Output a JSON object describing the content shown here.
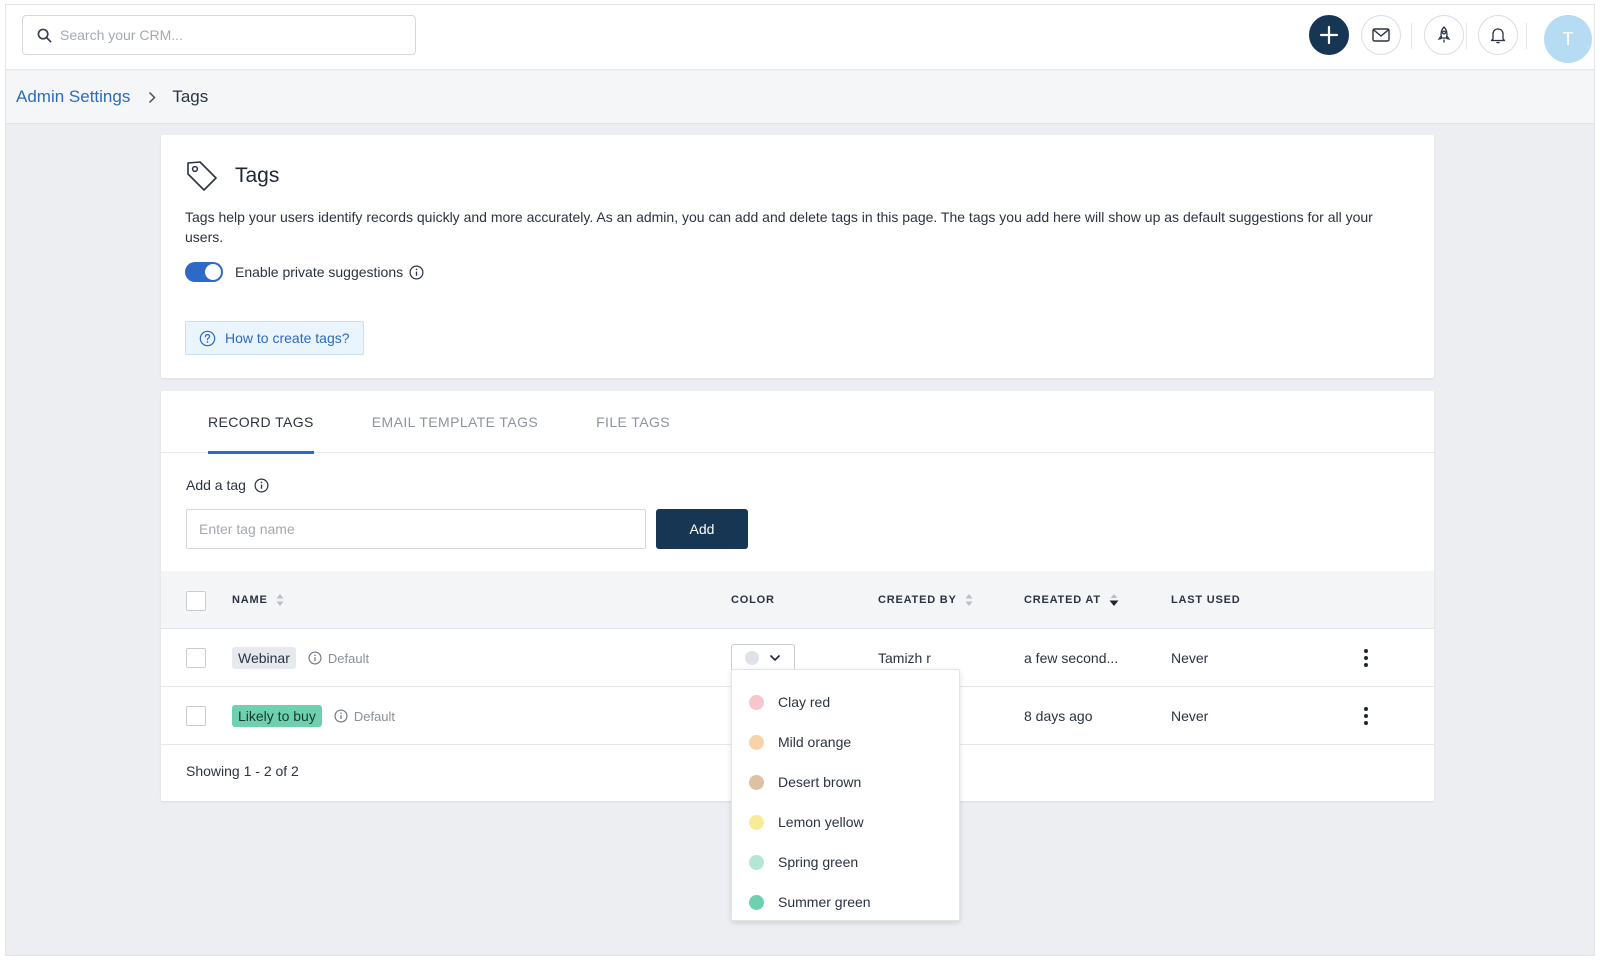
{
  "topbar": {
    "search_placeholder": "Search your CRM...",
    "avatar_initial": "T"
  },
  "breadcrumb": {
    "parent": "Admin Settings",
    "current": "Tags"
  },
  "info": {
    "title": "Tags",
    "description": "Tags help your users identify records quickly and more accurately. As an admin, you can add and delete tags in this page. The tags you add here will show up as default suggestions for all your users.",
    "toggle_label": "Enable private suggestions",
    "toggle_on": true,
    "help_label": "How to create tags?"
  },
  "tabs": [
    "RECORD TAGS",
    "EMAIL TEMPLATE TAGS",
    "FILE TAGS"
  ],
  "active_tab": "RECORD TAGS",
  "add_tag": {
    "label": "Add a tag",
    "placeholder": "Enter tag name",
    "button": "Add"
  },
  "table": {
    "columns": {
      "name": "NAME",
      "color": "COLOR",
      "created_by": "CREATED BY",
      "created_at": "CREATED AT",
      "last_used": "LAST USED"
    },
    "rows": [
      {
        "name": "Webinar",
        "badge": "Default",
        "created_by": "Tamizh r",
        "created_at": "a few second...",
        "last_used": "Never",
        "pill_color": "#e6e9ed"
      },
      {
        "name": "Likely to buy",
        "badge": "Default",
        "created_by": "",
        "created_at": "8 days ago",
        "last_used": "Never",
        "pill_color": "#6fd0b0"
      }
    ],
    "footer": "Showing 1 - 2 of 2"
  },
  "color_dropdown": {
    "options": [
      {
        "label": "Clay red",
        "color": "#f7c6cc"
      },
      {
        "label": "Mild orange",
        "color": "#f8d2aa"
      },
      {
        "label": "Desert brown",
        "color": "#dcc2a0"
      },
      {
        "label": "Lemon yellow",
        "color": "#f7eb9a"
      },
      {
        "label": "Spring green",
        "color": "#b4e6d8"
      },
      {
        "label": "Summer green",
        "color": "#6fd0b0"
      }
    ]
  },
  "colors": {
    "primary_dark": "#173653",
    "accent_blue": "#2d6ac7",
    "link_blue": "#2c6bbf"
  }
}
